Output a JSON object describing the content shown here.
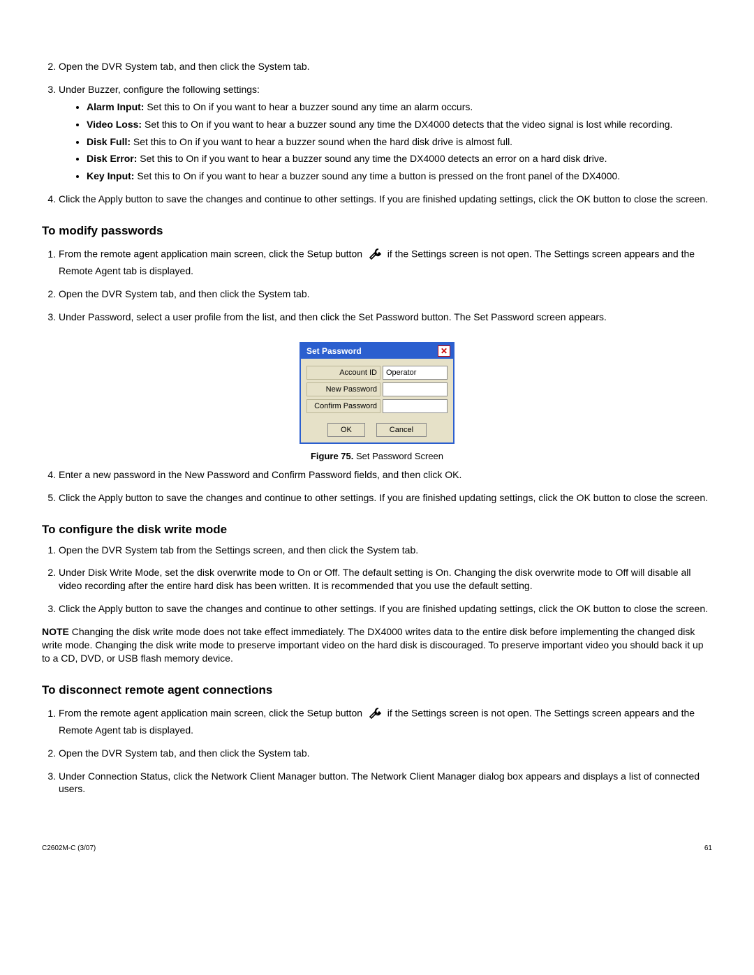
{
  "top": {
    "step2": "Open the DVR System tab, and then click the System tab.",
    "step3": "Under Buzzer, configure the following settings:",
    "bullets": {
      "b1_label": "Alarm Input:",
      "b1_text": " Set this to On if you want to hear a buzzer sound any time an alarm occurs.",
      "b2_label": "Video Loss:",
      "b2_text": " Set this to On if you want to hear a buzzer sound any time the DX4000 detects that the video signal is lost while recording.",
      "b3_label": "Disk Full:",
      "b3_text": " Set this to On if you want to hear a buzzer sound when the hard disk drive is almost full.",
      "b4_label": "Disk Error:",
      "b4_text": " Set this to On if you want to hear a buzzer sound any time the DX4000 detects an error on a hard disk drive.",
      "b5_label": "Key Input:",
      "b5_text": " Set this to On if you want to hear a buzzer sound any time a button is pressed on the front panel of the DX4000."
    },
    "step4": "Click the Apply button to save the changes and continue to other settings. If you are finished updating settings, click the OK button to close the screen."
  },
  "section_pw": {
    "title": "To modify passwords",
    "step1a": "From the remote agent application main screen, click the Setup button ",
    "step1b": " if the Settings screen is not open. The Settings screen appears and the Remote Agent tab is displayed.",
    "step2": "Open the DVR System tab, and then click the System tab.",
    "step3": "Under Password, select a user profile from the list, and then click the Set Password button. The Set Password screen appears.",
    "dialog": {
      "title": "Set Password",
      "row1_label": "Account ID",
      "row1_value": "Operator",
      "row2_label": "New Password",
      "row3_label": "Confirm Password",
      "ok": "OK",
      "cancel": "Cancel"
    },
    "figcap_b": "Figure 75.",
    "figcap_t": "  Set Password Screen",
    "step4": "Enter a new password in the New Password and Confirm Password fields, and then click OK.",
    "step5": "Click the Apply button to save the changes and continue to other settings. If you are finished updating settings, click the OK button to close the screen."
  },
  "section_disk": {
    "title": "To configure the disk write mode",
    "step1": "Open the DVR System tab from the Settings screen, and then click the System tab.",
    "step2": "Under Disk Write Mode, set the disk overwrite mode to On or Off. The default setting is On. Changing the disk overwrite mode to Off will disable all video recording after the entire hard disk has been written. It is recommended that you use the default setting.",
    "step3": "Click the Apply button to save the changes and continue to other settings. If you are finished updating settings, click the OK button to close the screen.",
    "note_label": "NOTE",
    "note_text": "  Changing the disk write mode does not take effect immediately. The DX4000 writes data to the entire disk before implementing the changed disk write mode. Changing the disk write mode to preserve important video on the hard disk is discouraged. To preserve important video you should back it up to a CD, DVD, or USB flash memory device."
  },
  "section_disc": {
    "title": "To disconnect remote agent connections",
    "step1a": "From the remote agent application main screen, click the Setup button ",
    "step1b": " if the Settings screen is not open. The Settings screen appears and the Remote Agent tab is displayed.",
    "step2": "Open the DVR System tab, and then click the System tab.",
    "step3": "Under Connection Status, click the Network Client Manager button. The Network Client Manager dialog box appears and displays a list of connected users."
  },
  "footer": {
    "left": "C2602M-C (3/07)",
    "right": "61"
  }
}
